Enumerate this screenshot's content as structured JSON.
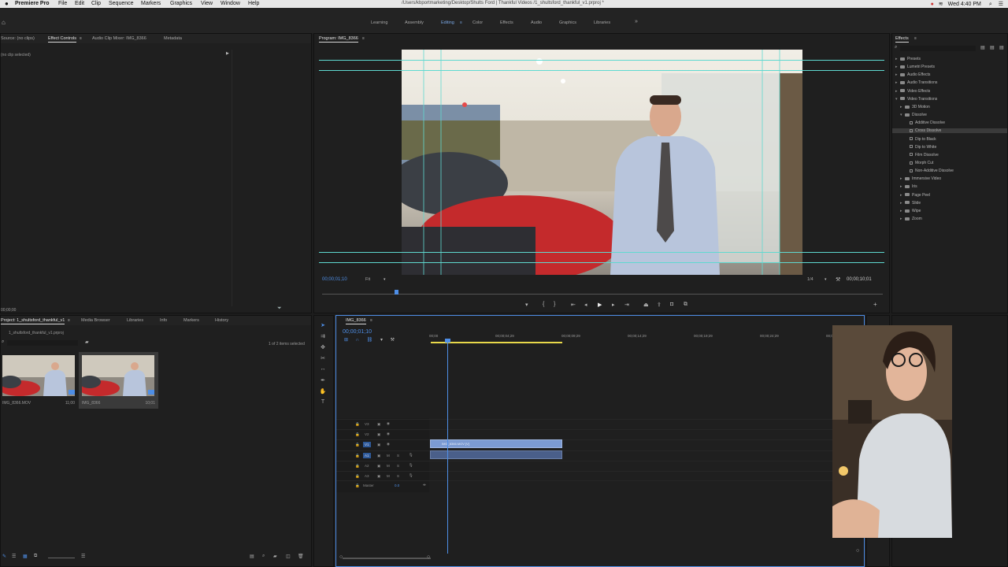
{
  "menubar": {
    "app_name": "Premiere Pro",
    "menus": [
      "File",
      "Edit",
      "Clip",
      "Sequence",
      "Markers",
      "Graphics",
      "View",
      "Window",
      "Help"
    ],
    "path": "/Users/kbportmarketing/Desktop/Shults Ford | Thankful Videos /1_shultsford_thankful_v1.prproj *",
    "clock": "Wed 4:40 PM"
  },
  "workspaces": [
    "Learning",
    "Assembly",
    "Editing",
    "Color",
    "Effects",
    "Audio",
    "Graphics",
    "Libraries"
  ],
  "workspace_active": "Editing",
  "source_panel": {
    "tabs": [
      "Source: (no clips)",
      "Effect Controls",
      "Audio Clip Mixer: IMG_8366",
      "Metadata"
    ],
    "active": "Effect Controls",
    "no_clip": "(no clip selected)",
    "timecode": "00;00;00"
  },
  "program": {
    "title": "Program: IMG_8366",
    "timecode": "00;00;01;10",
    "fit": "Fit",
    "resolution": "1/4",
    "duration": "00;00;10;01"
  },
  "effects_panel": {
    "title": "Effects",
    "items": [
      {
        "label": "Presets",
        "type": "folder",
        "level": 0
      },
      {
        "label": "Lumetri Presets",
        "type": "folder",
        "level": 0
      },
      {
        "label": "Audio Effects",
        "type": "folder",
        "level": 0
      },
      {
        "label": "Audio Transitions",
        "type": "folder",
        "level": 0
      },
      {
        "label": "Video Effects",
        "type": "folder",
        "level": 0
      },
      {
        "label": "Video Transitions",
        "type": "folder",
        "level": 0
      },
      {
        "label": "3D Motion",
        "type": "folder",
        "level": 1
      },
      {
        "label": "Dissolve",
        "type": "folder",
        "level": 1
      },
      {
        "label": "Additive Dissolve",
        "type": "fx",
        "level": 2
      },
      {
        "label": "Cross Dissolve",
        "type": "fx",
        "level": 2
      },
      {
        "label": "Dip to Black",
        "type": "fx",
        "level": 2
      },
      {
        "label": "Dip to White",
        "type": "fx",
        "level": 2
      },
      {
        "label": "Film Dissolve",
        "type": "fx",
        "level": 2
      },
      {
        "label": "Morph Cut",
        "type": "fx",
        "level": 2
      },
      {
        "label": "Non-Additive Dissolve",
        "type": "fx",
        "level": 2
      },
      {
        "label": "Immersive Video",
        "type": "folder",
        "level": 1
      },
      {
        "label": "Iris",
        "type": "folder",
        "level": 1
      },
      {
        "label": "Page Peel",
        "type": "folder",
        "level": 1
      },
      {
        "label": "Slide",
        "type": "folder",
        "level": 1
      },
      {
        "label": "Wipe",
        "type": "folder",
        "level": 1
      },
      {
        "label": "Zoom",
        "type": "folder",
        "level": 1
      }
    ]
  },
  "project_panel": {
    "tabs": [
      "Project: 1_shultsford_thankful_v1",
      "Media Browser",
      "Libraries",
      "Info",
      "Markers",
      "History"
    ],
    "active": "Project: 1_shultsford_thankful_v1",
    "file": "1_shultsford_thankful_v1.prproj",
    "selected_count": "1 of 2 items selected",
    "items": [
      {
        "name": "IMG_8366.MOV",
        "duration": "11;00"
      },
      {
        "name": "IMG_8366",
        "duration": "10;01"
      }
    ]
  },
  "timeline": {
    "tab": "IMG_8366",
    "timecode": "00;00;01;10",
    "ruler": [
      "00;00",
      "00;00;04;29",
      "00;00;09;29",
      "00;00;14;29",
      "00;00;19;29",
      "00;00;24;29",
      "00;00;29;29"
    ],
    "video_tracks": [
      "V3",
      "V2",
      "V1"
    ],
    "audio_tracks": [
      "A1",
      "A2",
      "A3"
    ],
    "master_label": "Master",
    "master_value": "0.0",
    "clip_label": "IMG_8366.MOV [V]"
  },
  "colors": {
    "accent": "#4e8ee6",
    "clip_video": "#7c9bd3",
    "clip_audio": "#4a5f8a",
    "guides": "#5fd9d0"
  }
}
